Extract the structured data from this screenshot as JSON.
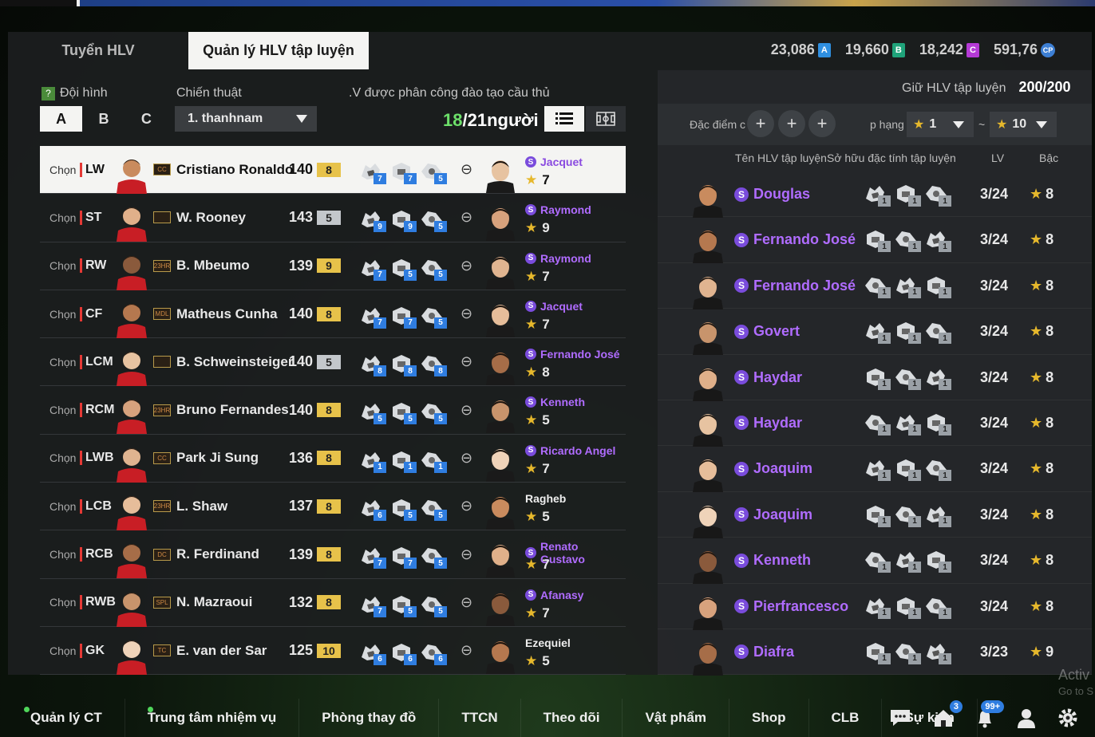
{
  "tabs": [
    "Tuyển HLV",
    "Quản lý HLV tập luyện"
  ],
  "currencies": [
    {
      "value": "23,086",
      "icon": "A",
      "color": "#2f8fe0"
    },
    {
      "value": "19,660",
      "icon": "B",
      "color": "#1fa37a"
    },
    {
      "value": "18,242",
      "icon": "C",
      "color": "#b53ad6"
    },
    {
      "value": "591,76",
      "icon": "CP",
      "color": "#3d7fd4"
    }
  ],
  "left": {
    "squad_label": "Đội hình",
    "tactic_label": "Chiến thuật",
    "assigned_label": ".V được phân công đào tạo cầu thủ",
    "squads": [
      "A",
      "B",
      "C"
    ],
    "tactic_value": "1. thanhnam",
    "count_current": "18",
    "count_total": "/21",
    "count_unit": "người",
    "choose_label": "Chọn"
  },
  "players": [
    {
      "pos": "LW",
      "season": "CC",
      "name": "Cristiano Ronaldo",
      "ovr": "140",
      "lvl": "8",
      "lvl_color": "gold",
      "traits": [
        "7",
        "7",
        "5"
      ],
      "coach": "Jacquet",
      "coach_badge": true,
      "stars": "7",
      "selected": true
    },
    {
      "pos": "ST",
      "season": "",
      "name": "W. Rooney",
      "ovr": "143",
      "lvl": "5",
      "lvl_color": "silver",
      "traits": [
        "9",
        "9",
        "5"
      ],
      "coach": "Raymond",
      "coach_badge": true,
      "stars": "9",
      "selected": false
    },
    {
      "pos": "RW",
      "season": "23HR",
      "name": "B. Mbeumo",
      "ovr": "139",
      "lvl": "9",
      "lvl_color": "gold",
      "traits": [
        "7",
        "5",
        "5"
      ],
      "coach": "Raymond",
      "coach_badge": true,
      "stars": "7",
      "selected": false
    },
    {
      "pos": "CF",
      "season": "MDL",
      "name": "Matheus Cunha",
      "ovr": "140",
      "lvl": "8",
      "lvl_color": "gold",
      "traits": [
        "7",
        "7",
        "5"
      ],
      "coach": "Jacquet",
      "coach_badge": true,
      "stars": "7",
      "selected": false
    },
    {
      "pos": "LCM",
      "season": "",
      "name": "B. Schweinsteiger",
      "ovr": "140",
      "lvl": "5",
      "lvl_color": "silver",
      "traits": [
        "8",
        "8",
        "8"
      ],
      "coach": "Fernando José",
      "coach_badge": true,
      "stars": "8",
      "selected": false
    },
    {
      "pos": "RCM",
      "season": "23HR",
      "name": "Bruno Fernandes",
      "ovr": "140",
      "lvl": "8",
      "lvl_color": "gold",
      "traits": [
        "5",
        "5",
        "5"
      ],
      "coach": "Kenneth",
      "coach_badge": true,
      "stars": "5",
      "selected": false
    },
    {
      "pos": "LWB",
      "season": "CC",
      "name": "Park Ji Sung",
      "ovr": "136",
      "lvl": "8",
      "lvl_color": "gold",
      "traits": [
        "1",
        "1",
        "1"
      ],
      "coach": "Ricardo Angel",
      "coach_badge": true,
      "stars": "7",
      "selected": false
    },
    {
      "pos": "LCB",
      "season": "23HR",
      "name": "L. Shaw",
      "ovr": "137",
      "lvl": "8",
      "lvl_color": "gold",
      "traits": [
        "6",
        "5",
        "5"
      ],
      "coach": "Ragheb",
      "coach_badge": false,
      "stars": "5",
      "selected": false
    },
    {
      "pos": "RCB",
      "season": "DC",
      "name": "R. Ferdinand",
      "ovr": "139",
      "lvl": "8",
      "lvl_color": "gold",
      "traits": [
        "7",
        "7",
        "5"
      ],
      "coach": "Renato Gustavo",
      "coach_badge": true,
      "stars": "7",
      "selected": false
    },
    {
      "pos": "RWB",
      "season": "SPL",
      "name": "N. Mazraoui",
      "ovr": "132",
      "lvl": "8",
      "lvl_color": "gold",
      "traits": [
        "7",
        "5",
        "5"
      ],
      "coach": "Afanasy",
      "coach_badge": true,
      "stars": "7",
      "selected": false
    },
    {
      "pos": "GK",
      "season": "TC",
      "name": "E. van der Sar",
      "ovr": "125",
      "lvl": "10",
      "lvl_color": "gold",
      "traits": [
        "6",
        "6",
        "6"
      ],
      "coach": "Ezequiel",
      "coach_badge": false,
      "stars": "5",
      "selected": false
    }
  ],
  "right": {
    "hold_label": "Giữ HLV tập luyện",
    "hold_value": "200/200",
    "feature_label": "Đặc điểm c",
    "rank_label": "p hạng",
    "rank_from": "1",
    "rank_to": "10",
    "tilde": "~",
    "col_name": "Tên HLV tập luyện",
    "col_owned": "Sở hữu đặc tính tập luyện",
    "col_lv": "LV",
    "col_tier": "Bậc"
  },
  "coaches": [
    {
      "name": "Douglas",
      "traits": [
        "1",
        "1",
        "1"
      ],
      "lv": "3/24",
      "tier": "8"
    },
    {
      "name": "Fernando José",
      "traits": [
        "1",
        "1",
        "1"
      ],
      "lv": "3/24",
      "tier": "8"
    },
    {
      "name": "Fernando José",
      "traits": [
        "1",
        "1",
        "1"
      ],
      "lv": "3/24",
      "tier": "8"
    },
    {
      "name": "Govert",
      "traits": [
        "1",
        "1",
        "1"
      ],
      "lv": "3/24",
      "tier": "8"
    },
    {
      "name": "Haydar",
      "traits": [
        "1",
        "1",
        "1"
      ],
      "lv": "3/24",
      "tier": "8"
    },
    {
      "name": "Haydar",
      "traits": [
        "1",
        "1",
        "1"
      ],
      "lv": "3/24",
      "tier": "8"
    },
    {
      "name": "Joaquim",
      "traits": [
        "1",
        "1",
        "1"
      ],
      "lv": "3/24",
      "tier": "8"
    },
    {
      "name": "Joaquim",
      "traits": [
        "1",
        "1",
        "1"
      ],
      "lv": "3/24",
      "tier": "8"
    },
    {
      "name": "Kenneth",
      "traits": [
        "1",
        "1",
        "1"
      ],
      "lv": "3/24",
      "tier": "8"
    },
    {
      "name": "Pierfrancesco",
      "traits": [
        "1",
        "1",
        "1"
      ],
      "lv": "3/24",
      "tier": "8"
    },
    {
      "name": "Diafra",
      "traits": [
        "1",
        "1",
        "1"
      ],
      "lv": "3/23",
      "tier": "9"
    }
  ],
  "bottom_nav": [
    {
      "label": "Quản lý CT",
      "dot": true
    },
    {
      "label": "Trung tâm nhiệm vụ",
      "dot": true
    },
    {
      "label": "Phòng thay đồ",
      "dot": false
    },
    {
      "label": "TTCN",
      "dot": false
    },
    {
      "label": "Theo dõi",
      "dot": false
    },
    {
      "label": "Vật phẩm",
      "dot": false
    },
    {
      "label": "Shop",
      "dot": false
    },
    {
      "label": "CLB",
      "dot": false
    },
    {
      "label": "Sự kiện",
      "dot": false
    }
  ],
  "bottom_icons": [
    {
      "icon": "chat-icon",
      "badge": ""
    },
    {
      "icon": "home-icon",
      "badge": "3"
    },
    {
      "icon": "bell-icon",
      "badge": "99+"
    },
    {
      "icon": "profile-icon",
      "badge": ""
    },
    {
      "icon": "settings-icon",
      "badge": ""
    }
  ],
  "watermark": {
    "line1": "Activ",
    "line2": "Go to S"
  },
  "star_glyph": "★"
}
